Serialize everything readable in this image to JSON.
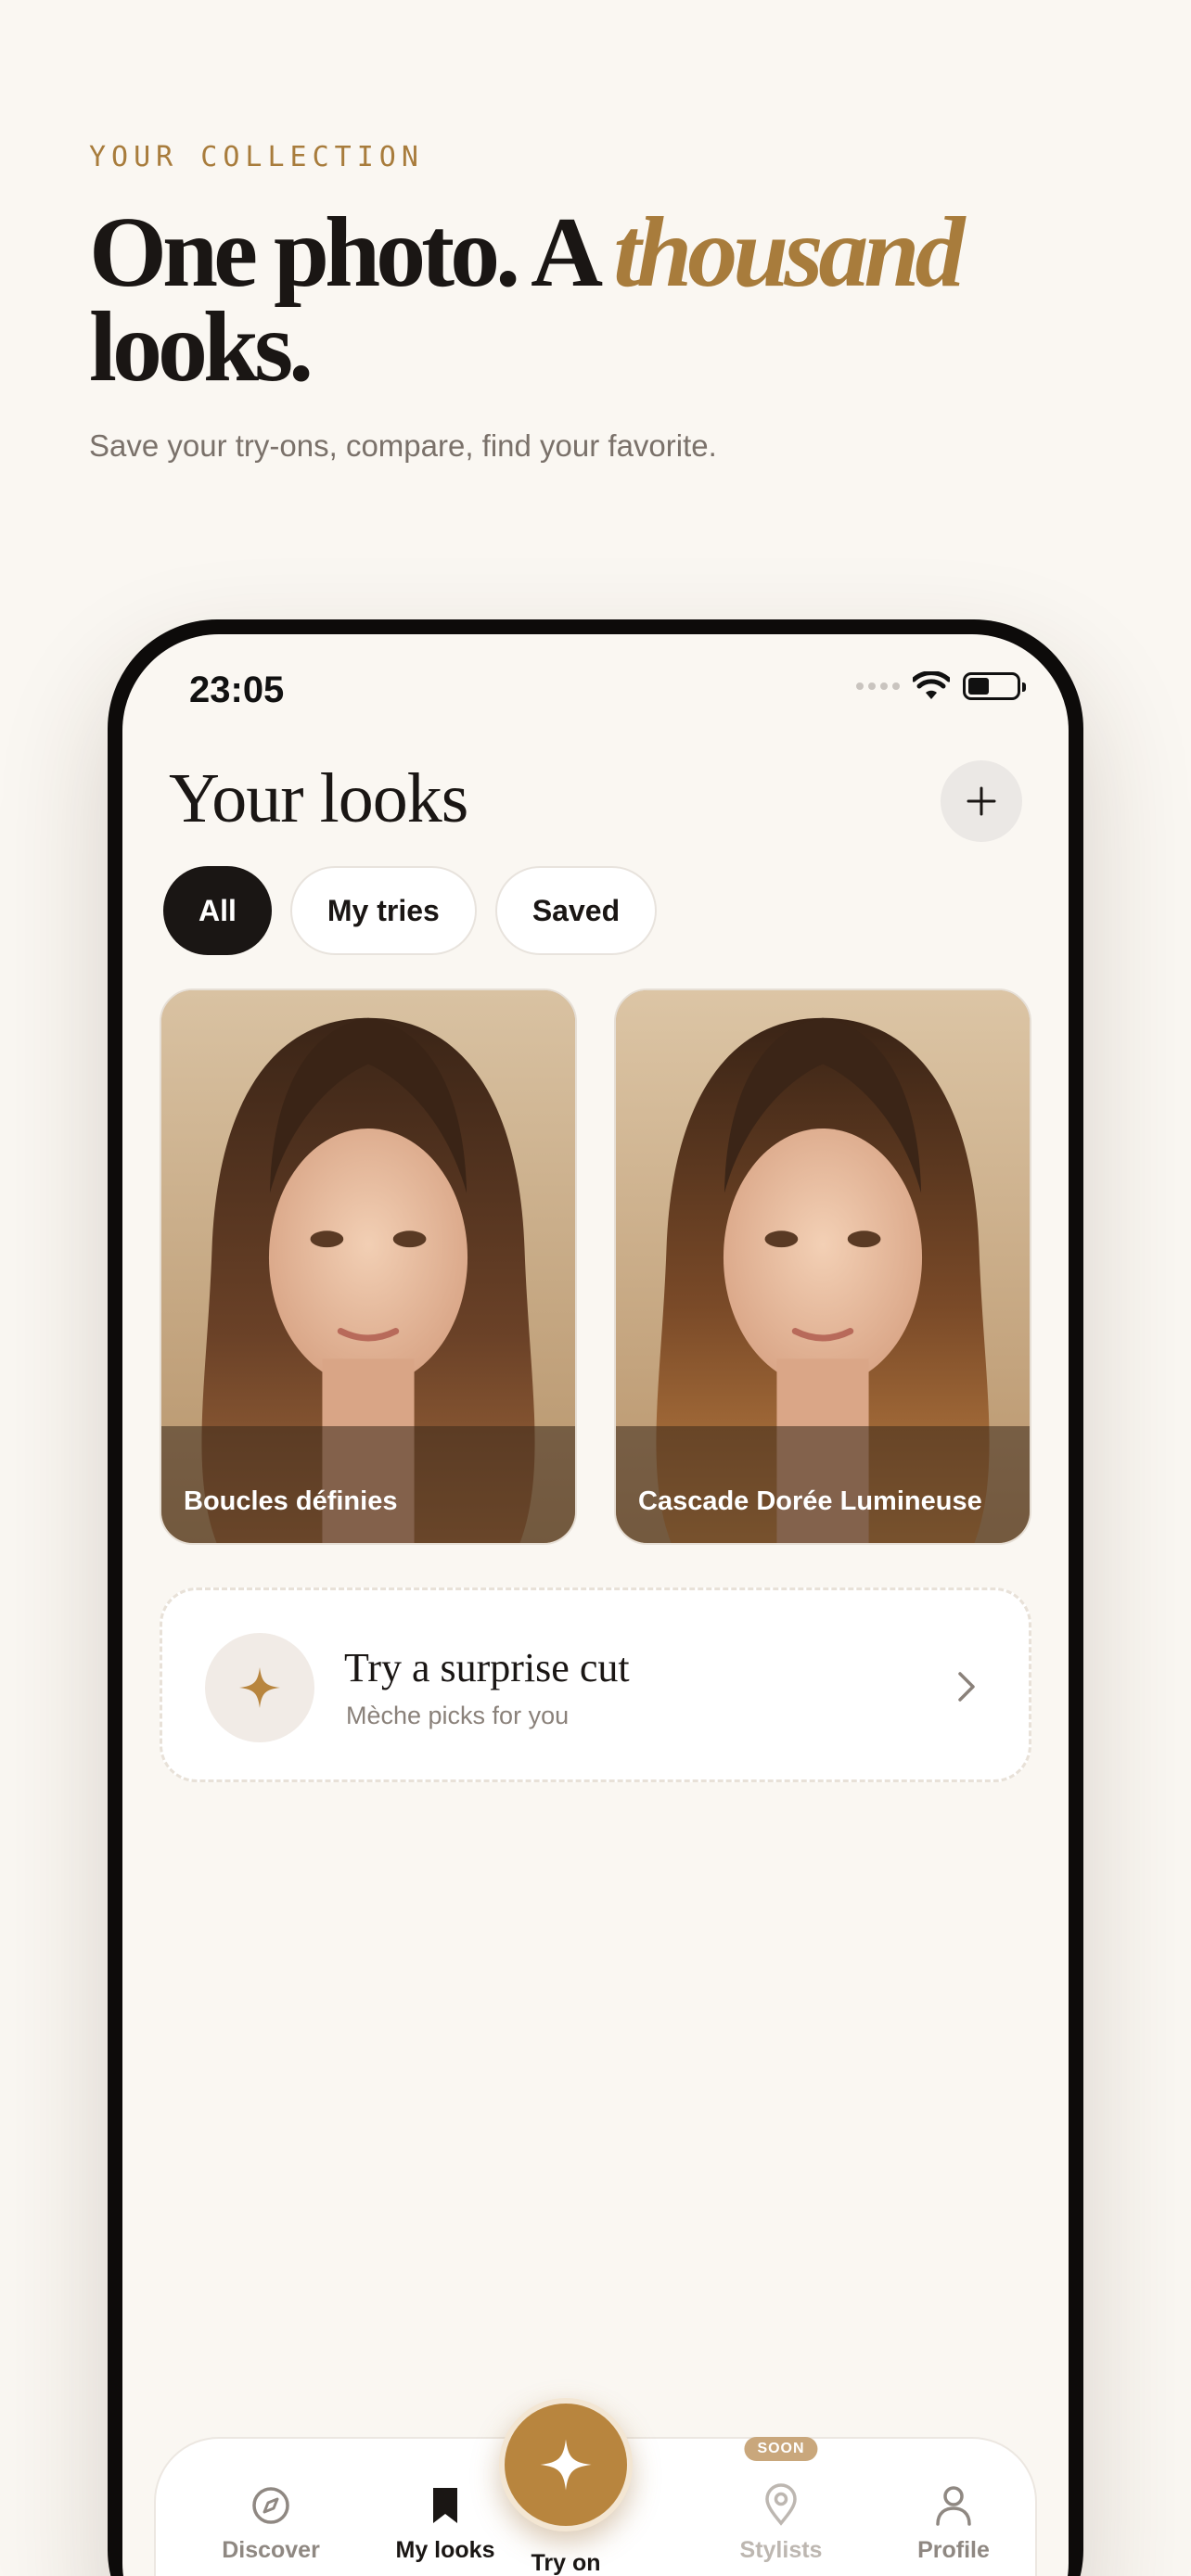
{
  "hero": {
    "eyebrow": "YOUR COLLECTION",
    "headline_part1": "One photo. A ",
    "headline_accent": "thousand",
    "headline_part2": "looks.",
    "subhead": "Save your try-ons, compare, find your favorite."
  },
  "status_bar": {
    "time": "23:05"
  },
  "screen": {
    "title": "Your looks",
    "add_icon": "plus-icon"
  },
  "filters": [
    {
      "label": "All",
      "active": true
    },
    {
      "label": "My tries",
      "active": false
    },
    {
      "label": "Saved",
      "active": false
    }
  ],
  "looks": [
    {
      "name": "Boucles définies"
    },
    {
      "name": "Cascade Dorée Lumineuse"
    }
  ],
  "surprise": {
    "title": "Try a surprise cut",
    "subtitle": "Mèche picks for you",
    "icon": "sparkle-icon"
  },
  "tabbar": {
    "discover": "Discover",
    "my_looks": "My looks",
    "try_on": "Try on",
    "stylists": "Stylists",
    "stylists_badge": "SOON",
    "profile": "Profile"
  },
  "colors": {
    "background": "#faf7f2",
    "accent": "#a87c3c",
    "fab": "#b8853e",
    "ink": "#1a1614"
  }
}
